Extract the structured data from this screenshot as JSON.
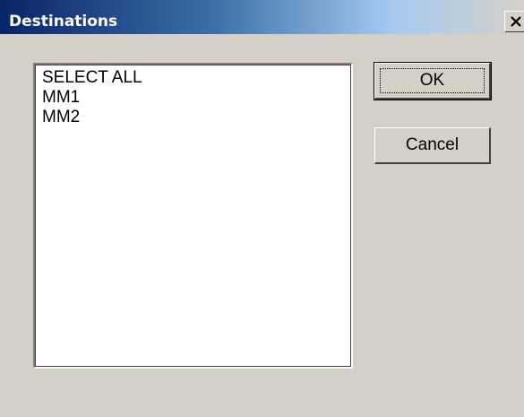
{
  "window": {
    "title": "Destinations"
  },
  "list": {
    "items": [
      "SELECT ALL",
      "MM1",
      "MM2"
    ]
  },
  "buttons": {
    "ok_label": "OK",
    "cancel_label": "Cancel"
  },
  "icons": {
    "close": "close-icon"
  },
  "colors": {
    "titlebar_start": "#0a246a",
    "titlebar_end": "#a6caf0",
    "dialog_bg": "#d4d0c8"
  }
}
